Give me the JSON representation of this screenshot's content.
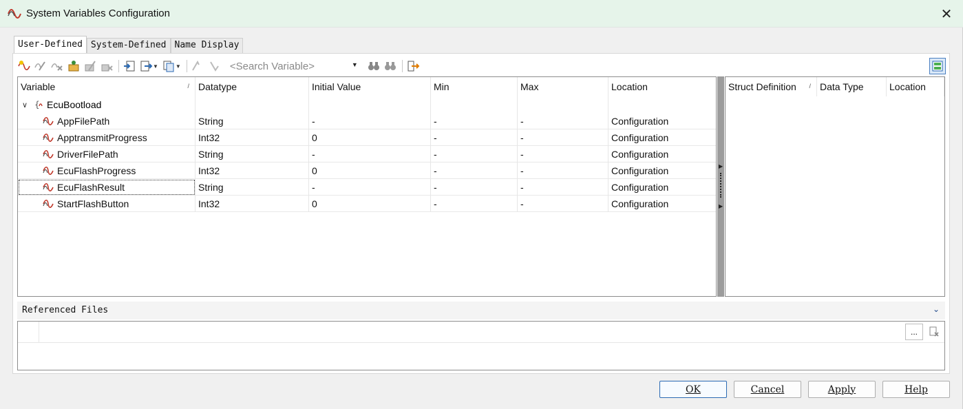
{
  "window": {
    "title": "System Variables Configuration",
    "close_glyph": "✕"
  },
  "tabs": [
    {
      "label": "User-Defined",
      "active": true
    },
    {
      "label": "System-Defined",
      "active": false
    },
    {
      "label": "Name Display",
      "active": false
    }
  ],
  "toolbar": {
    "search_placeholder": "<Search Variable>"
  },
  "grid": {
    "columns": [
      "Variable",
      "Datatype",
      "Initial Value",
      "Min",
      "Max",
      "Location"
    ],
    "group": {
      "name": "EcuBootload"
    },
    "rows": [
      {
        "variable": "AppFilePath",
        "datatype": "String",
        "initial": "-",
        "min": "-",
        "max": "-",
        "location": "Configuration"
      },
      {
        "variable": "ApptransmitProgress",
        "datatype": "Int32",
        "initial": "0",
        "min": "-",
        "max": "-",
        "location": "Configuration"
      },
      {
        "variable": "DriverFilePath",
        "datatype": "String",
        "initial": "-",
        "min": "-",
        "max": "-",
        "location": "Configuration"
      },
      {
        "variable": "EcuFlashProgress",
        "datatype": "Int32",
        "initial": "0",
        "min": "-",
        "max": "-",
        "location": "Configuration"
      },
      {
        "variable": "EcuFlashResult",
        "datatype": "String",
        "initial": "-",
        "min": "-",
        "max": "-",
        "location": "Configuration"
      },
      {
        "variable": "StartFlashButton",
        "datatype": "Int32",
        "initial": "0",
        "min": "-",
        "max": "-",
        "location": "Configuration"
      }
    ]
  },
  "struct_panel": {
    "columns": [
      "Struct Definition",
      "Data Type",
      "Location"
    ]
  },
  "referenced_files": {
    "label": "Referenced Files",
    "browse_label": "..."
  },
  "buttons": {
    "ok": "OK",
    "cancel": "Cancel",
    "apply": "Apply",
    "help": "Help"
  },
  "colors": {
    "accent": "#2a69b3",
    "titlebar": "#e6f4ea",
    "variable_icon": "#c0392b"
  }
}
